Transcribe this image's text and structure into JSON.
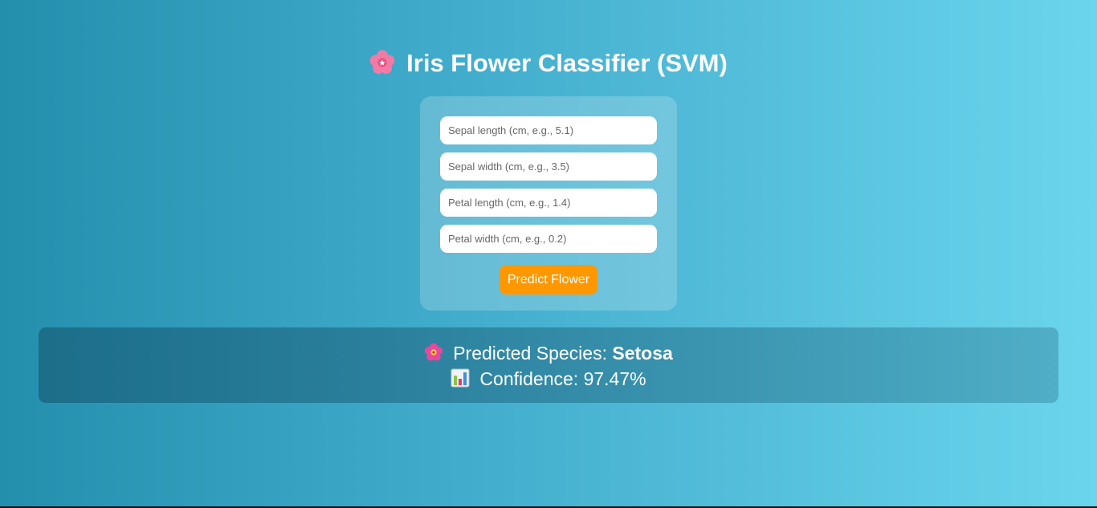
{
  "title": "Iris Flower Classifier (SVM)",
  "icons": {
    "title": "cherry-blossom-icon",
    "species": "hibiscus-icon",
    "confidence": "bar-chart-icon"
  },
  "form": {
    "fields": [
      {
        "placeholder": "Sepal length (cm, e.g., 5.1)",
        "value": ""
      },
      {
        "placeholder": "Sepal width (cm, e.g., 3.5)",
        "value": ""
      },
      {
        "placeholder": "Petal length (cm, e.g., 1.4)",
        "value": ""
      },
      {
        "placeholder": "Petal width (cm, e.g., 0.2)",
        "value": ""
      }
    ],
    "button_label": "Predict Flower"
  },
  "result": {
    "species_label": "Predicted Species:",
    "species_value": "Setosa",
    "confidence_label": "Confidence:",
    "confidence_value": "97.47%"
  },
  "colors": {
    "button": "#ff9800",
    "background_start": "#238fad",
    "background_end": "#6ad5ec"
  }
}
